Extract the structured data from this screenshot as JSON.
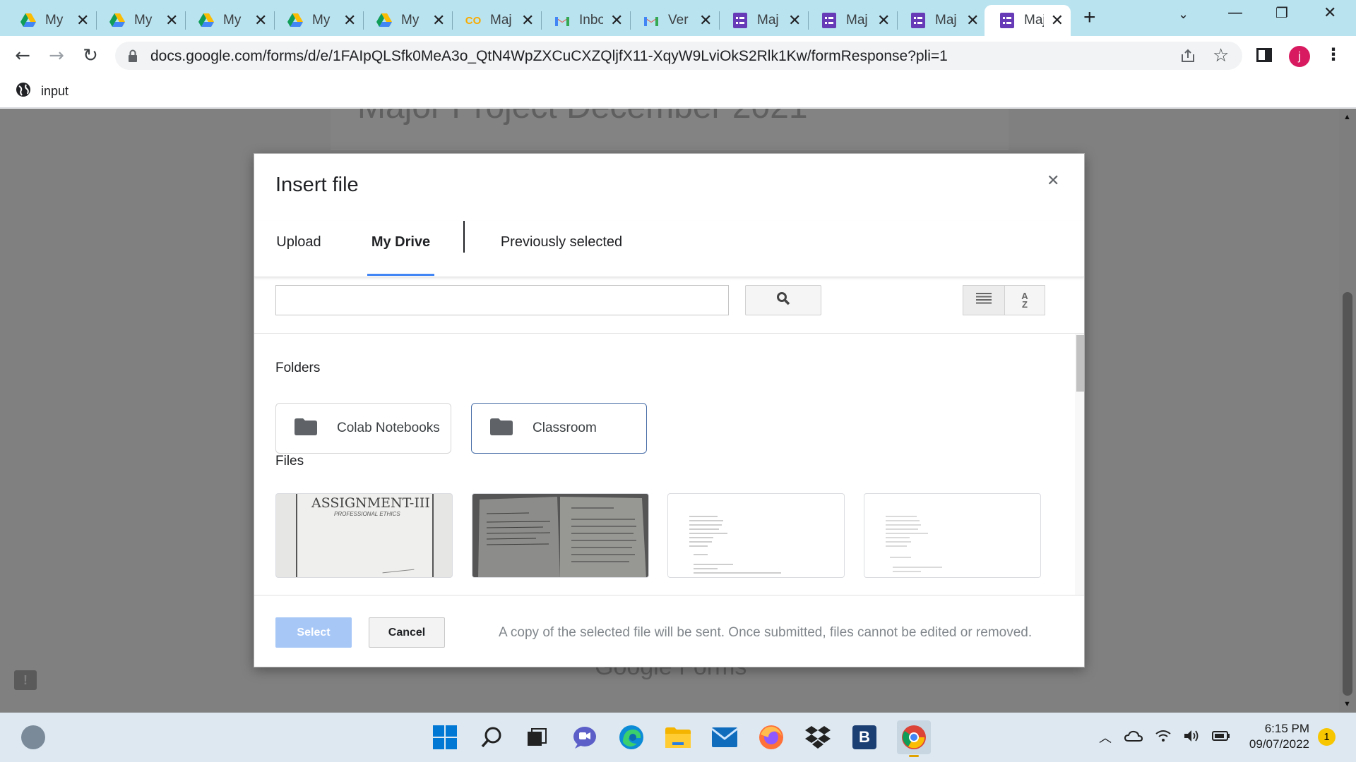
{
  "browser": {
    "tabs": [
      {
        "title": "My",
        "icon": "google-drive-icon"
      },
      {
        "title": "My",
        "icon": "google-drive-icon"
      },
      {
        "title": "My",
        "icon": "google-drive-icon"
      },
      {
        "title": "My",
        "icon": "google-drive-icon"
      },
      {
        "title": "My",
        "icon": "google-drive-icon"
      },
      {
        "title": "Maj",
        "icon": "colab-icon"
      },
      {
        "title": "Inbo",
        "icon": "gmail-icon"
      },
      {
        "title": "Ver",
        "icon": "gmail-icon"
      },
      {
        "title": "Maj",
        "icon": "google-forms-icon"
      },
      {
        "title": "Maj",
        "icon": "google-forms-icon"
      },
      {
        "title": "Maj",
        "icon": "google-forms-icon"
      },
      {
        "title": "Maj",
        "icon": "google-forms-icon",
        "active": true
      }
    ],
    "close_glyph": "✕",
    "new_tab_glyph": "+",
    "url": "docs.google.com/forms/d/e/1FAIpQLSfk0MeA3o_QtN4WpZXCuCXZQljfX11-XqyW9LviOkS2Rlk1Kw/formResponse?pli=1",
    "profile_initial": "j",
    "bookmark_label": "input"
  },
  "page": {
    "form_title": "Major Project December 2021",
    "footer_brand": "Google Forms"
  },
  "dialog": {
    "title": "Insert file",
    "tabs": [
      {
        "label": "Upload",
        "active": false
      },
      {
        "label": "My Drive",
        "active": true
      },
      {
        "label": "Previously selected",
        "active": false
      }
    ],
    "search_placeholder": "",
    "folders_heading": "Folders",
    "folders": [
      {
        "name": "Colab Notebooks",
        "selected": false
      },
      {
        "name": "Classroom",
        "selected": true
      }
    ],
    "files_heading": "Files",
    "files": [
      {
        "thumb_text": "ASSIGNMENT-III",
        "thumb_subtext": "PROFESSIONAL ETHICS"
      },
      {
        "thumb_text": "",
        "thumb_subtext": ""
      },
      {
        "thumb_text": "",
        "thumb_subtext": ""
      },
      {
        "thumb_text": "",
        "thumb_subtext": ""
      }
    ],
    "select_label": "Select",
    "cancel_label": "Cancel",
    "footer_note": "A copy of the selected file will be sent. Once submitted, files cannot be edited or removed.",
    "sort_label_top": "A",
    "sort_label_bottom": "Z"
  },
  "taskbar": {
    "time": "6:15 PM",
    "date": "09/07/2022",
    "notification_count": "1",
    "apps": [
      "windows-start-icon",
      "search-icon",
      "task-view-icon",
      "teams-chat-icon",
      "edge-icon",
      "file-explorer-icon",
      "mail-icon",
      "firefox-icon",
      "dropbox-icon",
      "b-app-icon",
      "chrome-icon"
    ]
  },
  "colors": {
    "tabstrip": "#b9e3ef",
    "accent_blue": "#4285f4",
    "select_disabled": "#a7c7f7",
    "forms_purple": "#673ab7",
    "overlay": "#808080"
  }
}
